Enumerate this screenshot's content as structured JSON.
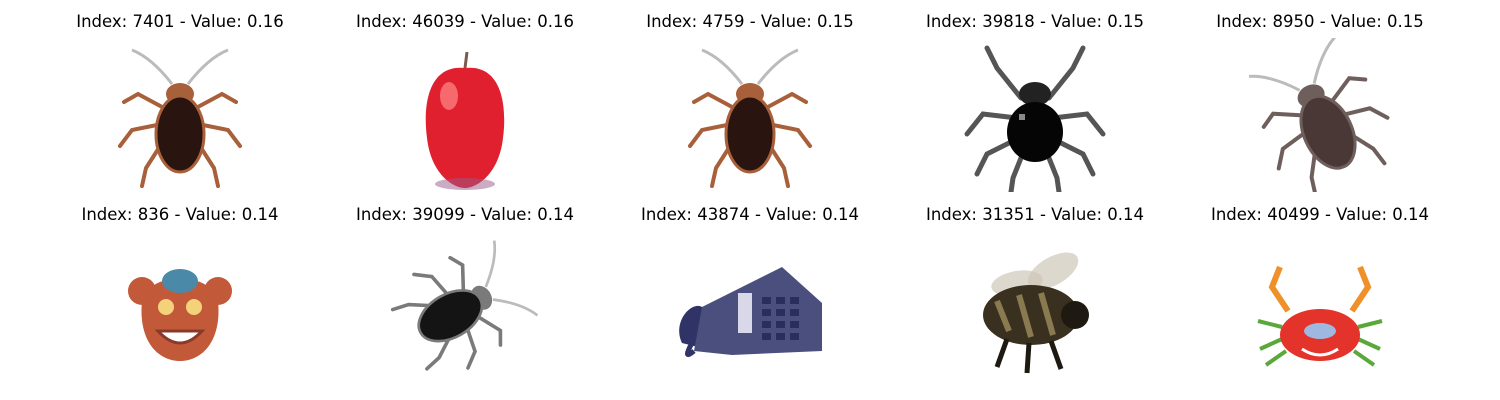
{
  "items": [
    {
      "title": "Index: 7401 - Value: 0.16",
      "subject": "cockroach-icon",
      "colors": {
        "body": "#2a1410",
        "legs": "#a8603a",
        "bg": "#ffffff"
      }
    },
    {
      "title": "Index: 46039 - Value: 0.16",
      "subject": "apple-icon",
      "colors": {
        "body": "#e0202e",
        "legs": "#7a5a4a",
        "bg": "#ffffff"
      }
    },
    {
      "title": "Index: 4759 - Value: 0.15",
      "subject": "cockroach-icon",
      "colors": {
        "body": "#2a1410",
        "legs": "#a8603a",
        "bg": "#ffffff"
      }
    },
    {
      "title": "Index: 39818 - Value: 0.15",
      "subject": "spider-icon",
      "colors": {
        "body": "#050505",
        "legs": "#555555",
        "bg": "#ffffff"
      }
    },
    {
      "title": "Index: 8950 - Value: 0.15",
      "subject": "cockroach-icon",
      "colors": {
        "body": "#4a3836",
        "legs": "#6f5f5c",
        "bg": "#ffffff"
      }
    },
    {
      "title": "Index: 836 - Value: 0.14",
      "subject": "crab-face-icon",
      "colors": {
        "body": "#c25a3a",
        "legs": "#8a3a2a",
        "bg": "#ffffff"
      }
    },
    {
      "title": "Index: 39099 - Value: 0.14",
      "subject": "cockroach-icon",
      "colors": {
        "body": "#141414",
        "legs": "#7a7a7a",
        "bg": "#ffffff"
      }
    },
    {
      "title": "Index: 43874 - Value: 0.14",
      "subject": "telephone-icon",
      "colors": {
        "body": "#4a4f7e",
        "legs": "#2f3366",
        "bg": "#ffffff"
      }
    },
    {
      "title": "Index: 31351 - Value: 0.14",
      "subject": "bee-icon",
      "colors": {
        "body": "#3a3020",
        "legs": "#1e1a12",
        "bg": "#ffffff"
      }
    },
    {
      "title": "Index: 40499 - Value: 0.14",
      "subject": "crab-icon",
      "colors": {
        "body": "#e4332a",
        "legs": "#f0902a",
        "bg": "#ffffff"
      }
    }
  ]
}
